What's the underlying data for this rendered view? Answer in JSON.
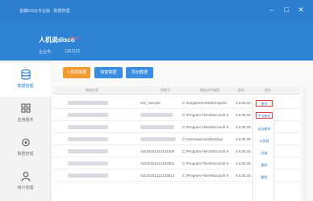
{
  "window": {
    "title": "金蝶KIS云专业版 - 数据管理",
    "minimize_icon": "minimize-icon",
    "maximize_icon": "maximize-icon",
    "close_icon": "close-icon"
  },
  "header": {
    "name": "人机说disco",
    "badge": "(Pro)",
    "sub_label": "企业号:",
    "sub_value": "1261123"
  },
  "sidebar": {
    "items": [
      {
        "label": "数据管理",
        "icon": "database-icon",
        "active": true
      },
      {
        "label": "应用服务",
        "icon": "apps-icon",
        "active": false
      },
      {
        "label": "数据管理",
        "icon": "gear-icon",
        "active": false
      },
      {
        "label": "用户管理",
        "icon": "user-icon",
        "active": false
      }
    ]
  },
  "toolbar": {
    "new_label": "+ 新建数据",
    "restore_label": "恢复数据",
    "import_label": "导出数据"
  },
  "table": {
    "columns": [
      "数据名称",
      "账套号",
      "数据文件路径",
      "版本",
      "操作"
    ],
    "rows": [
      {
        "name_blurred": true,
        "id": "KIS_Sample",
        "path": "C:\\Kingdee\\KIS\\DB\\Kisp3\\G",
        "ver": "3.0.05.00"
      },
      {
        "name_blurred": true,
        "id": "_______",
        "path": "C:\\Program Files\\Microsoft S",
        "ver": "3.0.05.00"
      },
      {
        "name_blurred": true,
        "id": "_______",
        "path": "C:\\Program Files\\Microsoft S",
        "ver": "3.0.05.00"
      },
      {
        "name_blurred": true,
        "id": "_______",
        "path": "C:\\Users\\weixin\\Desktop\\",
        "ver": "3.0.05.00"
      },
      {
        "name_blurred": true,
        "id": "AIS20181213101505",
        "path": "C:\\Program Files\\Microsoft S",
        "ver": "3.0.05.00"
      },
      {
        "name_blurred": true,
        "id": "AIS20181213102501",
        "path": "C:\\Program Files\\Microsoft S",
        "ver": "3.0.05.00"
      },
      {
        "name_blurred": true,
        "id": "AIS20181213103813",
        "path": "C:\\Program Files\\Microsoft S",
        "ver": "3.0.05.00"
      }
    ]
  },
  "actions": {
    "items": [
      "更多",
      "手动备份",
      "自动备份",
      "从恢复",
      "升级",
      "删除",
      "删除"
    ]
  }
}
